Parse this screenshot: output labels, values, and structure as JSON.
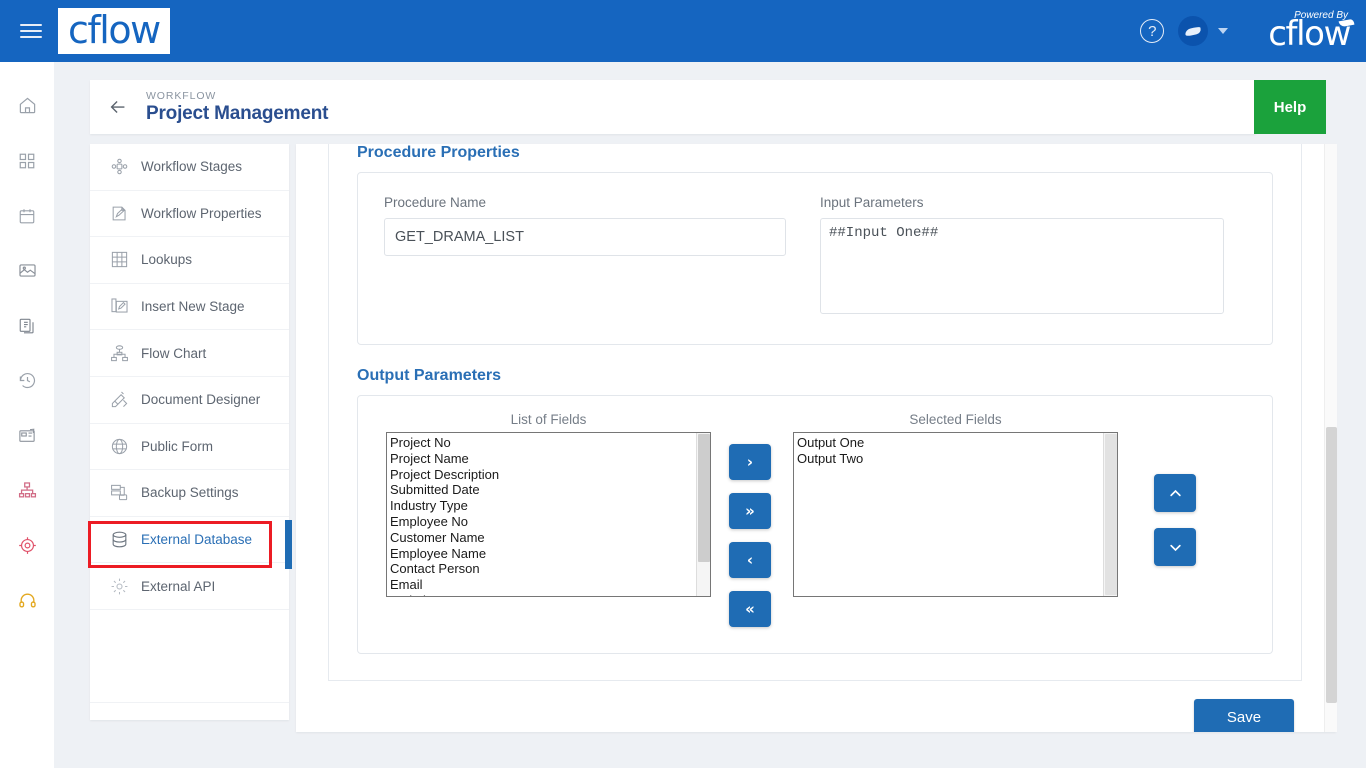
{
  "topbar": {
    "menu_icon": "hamburger-icon",
    "brand": "cflow",
    "help_icon": "question-circle-icon",
    "avatar_icon": "user-avatar",
    "chevron_icon": "chevron-down-icon",
    "powered_by_label": "Powered By",
    "powered_by_brand": "cflow",
    "bg_color": "#1565c0"
  },
  "rail": {
    "items": [
      {
        "name": "home-icon",
        "color": "#9aa1aa"
      },
      {
        "name": "apps-grid-icon",
        "color": "#9aa1aa"
      },
      {
        "name": "calendar-icon",
        "color": "#9aa1aa"
      },
      {
        "name": "image-report-icon",
        "color": "#8a9099"
      },
      {
        "name": "documents-icon",
        "color": "#7d848d"
      },
      {
        "name": "history-clock-icon",
        "color": "#9aa1aa"
      },
      {
        "name": "kanban-board-icon",
        "color": "#8e949d"
      },
      {
        "name": "org-chart-icon",
        "color": "#d16b85"
      },
      {
        "name": "target-icon",
        "color": "#e0526a"
      },
      {
        "name": "headset-support-icon",
        "color": "#e3a81f"
      }
    ]
  },
  "header": {
    "back_icon": "back-arrow-icon",
    "breadcrumb": "WORKFLOW",
    "title": "Project Management",
    "help_button": "Help",
    "help_color": "#1ba23c"
  },
  "sidemenu": {
    "items": [
      {
        "label": "Workflow Stages",
        "icon": "workflow-stages-icon",
        "active": false
      },
      {
        "label": "Workflow Properties",
        "icon": "workflow-properties-icon",
        "active": false
      },
      {
        "label": "Lookups",
        "icon": "lookups-grid-icon",
        "active": false
      },
      {
        "label": "Insert New Stage",
        "icon": "insert-new-stage-icon",
        "active": false
      },
      {
        "label": "Flow Chart",
        "icon": "flow-chart-icon",
        "active": false
      },
      {
        "label": "Document Designer",
        "icon": "document-designer-icon",
        "active": false
      },
      {
        "label": "Public Form",
        "icon": "public-form-globe-icon",
        "active": false
      },
      {
        "label": "Backup Settings",
        "icon": "backup-settings-icon",
        "active": false
      },
      {
        "label": "External Database",
        "icon": "database-icon",
        "active": true
      },
      {
        "label": "External API",
        "icon": "external-api-gear-icon",
        "active": false
      }
    ],
    "active_color": "#2a6fb5",
    "annotation_color": "#ec1c24"
  },
  "procedure_properties": {
    "section_title": "Procedure Properties",
    "procedure_name_label": "Procedure Name",
    "procedure_name_value": "GET_DRAMA_LIST",
    "procedure_name_placeholder": "Procedure Name",
    "input_parameters_label": "Input Parameters",
    "input_parameters_value": "##Input One##",
    "input_parameters_placeholder": "Input Parameters"
  },
  "output_parameters": {
    "section_title": "Output Parameters",
    "list_of_fields_label": "List of Fields",
    "selected_fields_label": "Selected Fields",
    "list_of_fields": [
      "Project No",
      "Project Name",
      "Project Description",
      "Submitted Date",
      "Industry Type",
      "Employee No",
      "Customer Name",
      "Employee Name",
      "Contact Person",
      "Email",
      "Website"
    ],
    "selected_fields": [
      "Output One",
      "Output Two"
    ],
    "transfer_buttons": [
      {
        "name": "move-right-button",
        "glyph": "›"
      },
      {
        "name": "move-all-right-button",
        "glyph": "»"
      },
      {
        "name": "move-left-button",
        "glyph": "‹"
      },
      {
        "name": "move-all-left-button",
        "glyph": "«"
      }
    ],
    "order_buttons": [
      {
        "name": "move-up-button",
        "glyph": "⌃"
      },
      {
        "name": "move-down-button",
        "glyph": "⌄"
      }
    ]
  },
  "footer": {
    "save_label": "Save",
    "save_color": "#1f6cb4"
  }
}
